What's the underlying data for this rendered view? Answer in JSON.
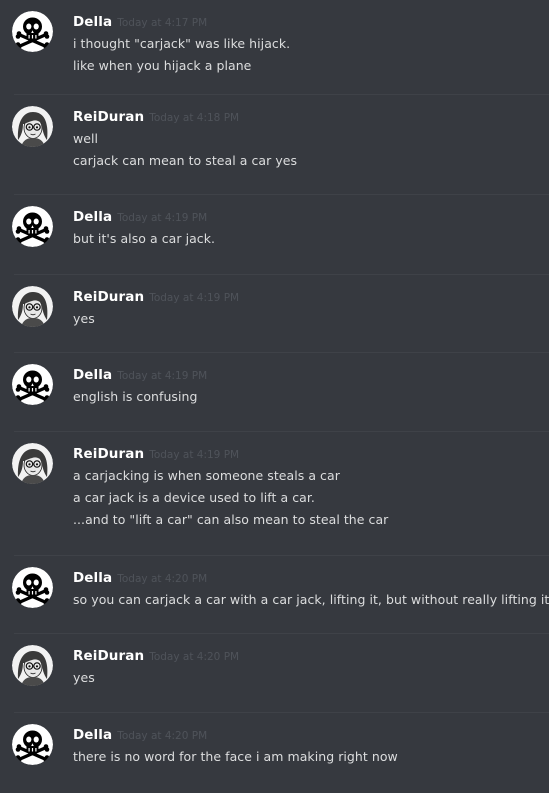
{
  "messages": [
    {
      "author": "Della",
      "avatar": "skull-crossbones-icon",
      "timestamp": "Today at 4:17 PM",
      "lines": [
        "i thought \"carjack\" was like hijack.",
        "like when you hijack a plane"
      ]
    },
    {
      "author": "ReiDuran",
      "avatar": "girl-portrait-icon",
      "timestamp": "Today at 4:18 PM",
      "lines": [
        "well",
        "carjack can mean to steal a car yes"
      ]
    },
    {
      "author": "Della",
      "avatar": "skull-crossbones-icon",
      "timestamp": "Today at 4:19 PM",
      "lines": [
        "but it's also a car jack."
      ]
    },
    {
      "author": "ReiDuran",
      "avatar": "girl-portrait-icon",
      "timestamp": "Today at 4:19 PM",
      "lines": [
        "yes"
      ]
    },
    {
      "author": "Della",
      "avatar": "skull-crossbones-icon",
      "timestamp": "Today at 4:19 PM",
      "lines": [
        "english is confusing"
      ]
    },
    {
      "author": "ReiDuran",
      "avatar": "girl-portrait-icon",
      "timestamp": "Today at 4:19 PM",
      "lines": [
        "a carjacking is when someone steals a car",
        "a car jack is a device used to lift a car.",
        "...and to \"lift a car\" can also mean to steal the car"
      ]
    },
    {
      "author": "Della",
      "avatar": "skull-crossbones-icon",
      "timestamp": "Today at 4:20 PM",
      "lines": [
        "so you can carjack a car with a car jack, lifting it, but without really lifting it."
      ]
    },
    {
      "author": "ReiDuran",
      "avatar": "girl-portrait-icon",
      "timestamp": "Today at 4:20 PM",
      "lines": [
        "yes"
      ]
    },
    {
      "author": "Della",
      "avatar": "skull-crossbones-icon",
      "timestamp": "Today at 4:20 PM",
      "lines": [
        "there is no word for the face i am making right now"
      ]
    }
  ],
  "colors": {
    "background": "#36393f",
    "username": "#ffffff",
    "timestamp": "#4f535a",
    "message_text": "#dcddde",
    "divider": "#3f4248"
  }
}
